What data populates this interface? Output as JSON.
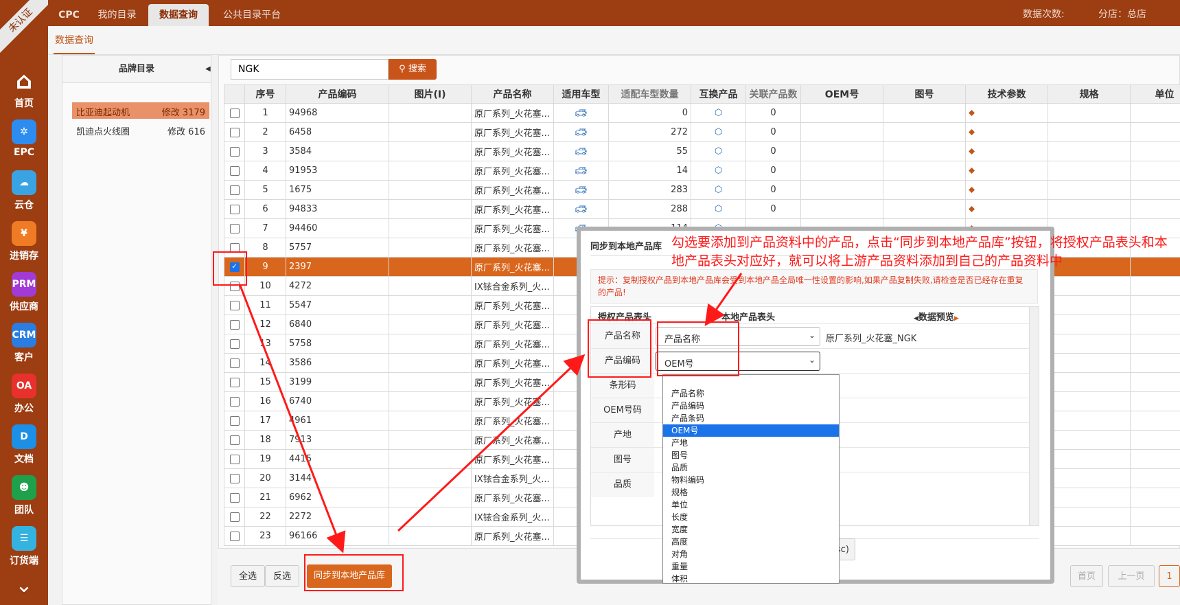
{
  "badge": "未认证",
  "nav": [
    {
      "label": "首页",
      "icon": "home-icon",
      "color": "#9c3d12",
      "glyph": "⌂"
    },
    {
      "label": "EPC",
      "icon": "epc-icon",
      "color": "#2d8cf0",
      "glyph": "✲"
    },
    {
      "label": "云仓",
      "icon": "cloud-icon",
      "color": "#3aa3e3",
      "glyph": "☁"
    },
    {
      "label": "进销存",
      "icon": "yen-icon",
      "color": "#f07b25",
      "glyph": "¥"
    },
    {
      "label": "供应商",
      "icon": "prm-icon",
      "color": "#a23ad6",
      "glyph": "PRM"
    },
    {
      "label": "客户",
      "icon": "crm-icon",
      "color": "#2a7de1",
      "glyph": "CRM"
    },
    {
      "label": "办公",
      "icon": "oa-icon",
      "color": "#e8312d",
      "glyph": "OA"
    },
    {
      "label": "文档",
      "icon": "doc-icon",
      "color": "#1c8fe6",
      "glyph": "D"
    },
    {
      "label": "团队",
      "icon": "team-icon",
      "color": "#1ea14a",
      "glyph": "☻"
    },
    {
      "label": "订货端",
      "icon": "order-icon",
      "color": "#35b3e0",
      "glyph": "☰"
    }
  ],
  "top": {
    "tabs": [
      "CPC",
      "我的目录",
      "数据查询",
      "公共目录平台"
    ],
    "right_count": "数据次数:",
    "right_branch": "分店：总店"
  },
  "subtab": "数据查询",
  "left": {
    "title": "品牌目录",
    "items": [
      {
        "name": "比亚迪起动机",
        "meta": "修改 3179"
      },
      {
        "name": "凯迪点火线圈",
        "meta": "修改 616"
      }
    ]
  },
  "search": {
    "value": "NGK",
    "button": "搜索"
  },
  "table": {
    "headers": [
      "序号",
      "产品编码",
      "图片(I)",
      "产品名称",
      "适用车型",
      "适配车型数量",
      "互换产品",
      "关联产品数",
      "OEM号",
      "图号",
      "技术参数",
      "规格",
      "单位"
    ],
    "rows": [
      {
        "no": "1",
        "code": "94968",
        "name": "原厂系列_火花塞...",
        "qty": "0",
        "rel": "0"
      },
      {
        "no": "2",
        "code": "6458",
        "name": "原厂系列_火花塞...",
        "qty": "272",
        "rel": "0"
      },
      {
        "no": "3",
        "code": "3584",
        "name": "原厂系列_火花塞...",
        "qty": "55",
        "rel": "0"
      },
      {
        "no": "4",
        "code": "91953",
        "name": "原厂系列_火花塞...",
        "qty": "14",
        "rel": "0"
      },
      {
        "no": "5",
        "code": "1675",
        "name": "原厂系列_火花塞...",
        "qty": "283",
        "rel": "0"
      },
      {
        "no": "6",
        "code": "94833",
        "name": "原厂系列_火花塞...",
        "qty": "288",
        "rel": "0"
      },
      {
        "no": "7",
        "code": "94460",
        "name": "原厂系列_火花塞...",
        "qty": "114",
        "rel": ""
      },
      {
        "no": "8",
        "code": "5757",
        "name": "原厂系列_火花塞...",
        "qty": "",
        "rel": ""
      },
      {
        "no": "9",
        "code": "2397",
        "name": "原厂系列_火花塞...",
        "qty": "",
        "rel": ""
      },
      {
        "no": "10",
        "code": "4272",
        "name": "IX铱合金系列_火...",
        "qty": "",
        "rel": ""
      },
      {
        "no": "11",
        "code": "5547",
        "name": "原厂系列_火花塞...",
        "qty": "",
        "rel": ""
      },
      {
        "no": "12",
        "code": "6840",
        "name": "原厂系列_火花塞...",
        "qty": "",
        "rel": ""
      },
      {
        "no": "13",
        "code": "5758",
        "name": "原厂系列_火花塞...",
        "qty": "",
        "rel": ""
      },
      {
        "no": "14",
        "code": "3586",
        "name": "原厂系列_火花塞...",
        "qty": "",
        "rel": ""
      },
      {
        "no": "15",
        "code": "3199",
        "name": "原厂系列_火花塞...",
        "qty": "",
        "rel": ""
      },
      {
        "no": "16",
        "code": "6740",
        "name": "原厂系列_火花塞...",
        "qty": "",
        "rel": ""
      },
      {
        "no": "17",
        "code": "4961",
        "name": "原厂系列_火花塞...",
        "qty": "",
        "rel": ""
      },
      {
        "no": "18",
        "code": "7913",
        "name": "原厂系列_火花塞...",
        "qty": "",
        "rel": ""
      },
      {
        "no": "19",
        "code": "4415",
        "name": "原厂系列_火花塞...",
        "qty": "",
        "rel": ""
      },
      {
        "no": "20",
        "code": "3144",
        "name": "IX铱合金系列_火...",
        "qty": "",
        "rel": ""
      },
      {
        "no": "21",
        "code": "6962",
        "name": "原厂系列_火花塞...",
        "qty": "",
        "rel": ""
      },
      {
        "no": "22",
        "code": "2272",
        "name": "IX铱合金系列_火...",
        "qty": "",
        "rel": ""
      },
      {
        "no": "23",
        "code": "96166",
        "name": "原厂系列_火花塞...",
        "qty": "",
        "rel": ""
      }
    ],
    "selected_row": "9"
  },
  "footer": {
    "select_all": "全选",
    "invert": "反选",
    "sync": "同步到本地产品库",
    "first": "首页",
    "prev": "上一页",
    "page": "1"
  },
  "modal": {
    "title": "同步到本地产品库",
    "tip": "提示：复制授权产品到本地产品库会受到本地产品全局唯一性设置的影响,如果产品复制失败,请检查是否已经存在重复的产品!",
    "col_auth": "授权产品表头",
    "col_local": "本地产品表头",
    "col_preview": "数据预览",
    "rows": [
      {
        "label": "产品名称",
        "value": "产品名称",
        "preview": "原厂系列_火花塞_NGK"
      },
      {
        "label": "产品编码",
        "value": "OEM号",
        "preview": ""
      },
      {
        "label": "条形码",
        "value": "",
        "preview": ""
      },
      {
        "label": "OEM号码",
        "value": "",
        "preview": ""
      },
      {
        "label": "产地",
        "value": "",
        "preview": ""
      },
      {
        "label": "图号",
        "value": "",
        "preview": ""
      },
      {
        "label": "品质",
        "value": "",
        "preview": ""
      }
    ],
    "options": [
      "产品名称",
      "产品编码",
      "产品条码",
      "OEM号",
      "产地",
      "图号",
      "品质",
      "物料编码",
      "规格",
      "单位",
      "长度",
      "宽度",
      "高度",
      "对角",
      "重量",
      "体积"
    ],
    "highlighted": "OEM号",
    "esc_fragment": "sc)"
  },
  "annotation": "勾选要添加到产品资料中的产品，点击“同步到本地产品库”按钮，将授权产品表头和本地产品表头对应好，就可以将上游产品资料添加到自己的产品资料中",
  "colors": {
    "brand": "#9c3d12",
    "accent": "#d9661d",
    "annotation": "#ff1a1a",
    "highlight": "#1a73e8"
  }
}
